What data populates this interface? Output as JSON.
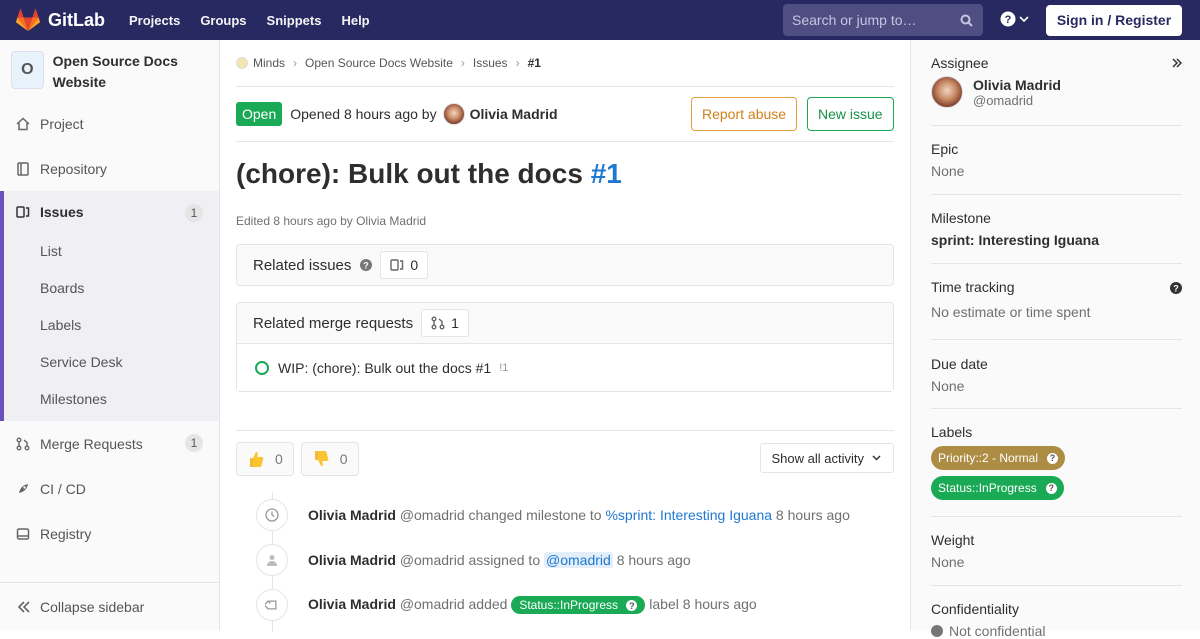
{
  "topbar": {
    "brand": "GitLab",
    "nav": [
      "Projects",
      "Groups",
      "Snippets",
      "Help"
    ],
    "search_placeholder": "Search or jump to…",
    "signin_label": "Sign in / Register"
  },
  "sidebar": {
    "project_initial": "O",
    "project_name": "Open Source Docs Website",
    "items": [
      {
        "label": "Project",
        "icon": "home-icon"
      },
      {
        "label": "Repository",
        "icon": "repository-icon"
      },
      {
        "label": "Issues",
        "icon": "issues-icon",
        "badge": "1"
      },
      {
        "label": "Merge Requests",
        "icon": "merge-request-icon",
        "badge": "1"
      },
      {
        "label": "CI / CD",
        "icon": "rocket-icon"
      },
      {
        "label": "Registry",
        "icon": "disk-icon"
      }
    ],
    "issues_sub": [
      "List",
      "Boards",
      "Labels",
      "Service Desk",
      "Milestones"
    ],
    "collapse_label": "Collapse sidebar"
  },
  "breadcrumb": [
    "Minds",
    "Open Source Docs Website",
    "Issues",
    "#1"
  ],
  "issue": {
    "status": "Open",
    "opened_text": "Opened 8 hours ago by",
    "author": "Olivia Madrid",
    "report_abuse_label": "Report abuse",
    "new_issue_label": "New issue",
    "title": "(chore): Bulk out the docs",
    "number": "#1",
    "edited": "Edited 8 hours ago by Olivia Madrid"
  },
  "related_issues": {
    "label": "Related issues",
    "count": "0"
  },
  "related_mrs": {
    "label": "Related merge requests",
    "count": "1",
    "items": [
      {
        "title": "WIP: (chore): Bulk out the docs #1",
        "ref": "!1"
      }
    ]
  },
  "awards": {
    "thumbsup": "0",
    "thumbsdown": "0",
    "filter_label": "Show all activity"
  },
  "timeline": [
    {
      "icon": "clock-icon",
      "author": "Olivia Madrid",
      "handle": "@omadrid",
      "action": "changed milestone to",
      "target": "%sprint: Interesting Iguana",
      "time": "8 hours ago"
    },
    {
      "icon": "user-icon",
      "author": "Olivia Madrid",
      "handle": "@omadrid",
      "action": "assigned to",
      "target": "@omadrid",
      "time": "8 hours ago"
    },
    {
      "icon": "label-icon",
      "author": "Olivia Madrid",
      "handle": "@omadrid",
      "action": "added",
      "target": "Status::InProgress",
      "suffix": "label",
      "time": "8 hours ago"
    }
  ],
  "right": {
    "assignee_title": "Assignee",
    "assignee_name": "Olivia Madrid",
    "assignee_handle": "@omadrid",
    "epic_title": "Epic",
    "epic_value": "None",
    "milestone_title": "Milestone",
    "milestone_value": "sprint: Interesting Iguana",
    "time_title": "Time tracking",
    "time_value": "No estimate or time spent",
    "due_title": "Due date",
    "due_value": "None",
    "labels_title": "Labels",
    "labels": [
      {
        "text": "Priority::2 - Normal",
        "color": "#ad8d43"
      },
      {
        "text": "Status::InProgress",
        "color": "#1aaa55"
      }
    ],
    "weight_title": "Weight",
    "weight_value": "None",
    "confidentiality_title": "Confidentiality",
    "confidentiality_value": "Not confidential"
  }
}
